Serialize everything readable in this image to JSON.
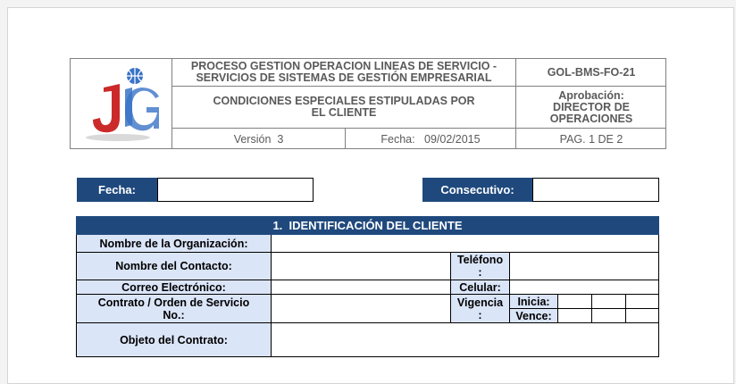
{
  "header": {
    "process_line1": "PROCESO GESTION OPERACION LINEAS DE SERVICIO -",
    "process_line2": "SERVICIOS DE SISTEMAS DE GESTIÓN EMPRESARIAL",
    "doc_code": "GOL-BMS-FO-21",
    "doc_title": "CONDICIONES ESPECIALES ESTIPULADAS POR EL CLIENTE",
    "approval_label": "Aprobación:",
    "approval_value": "DIRECTOR DE OPERACIONES",
    "version": "Versión  3",
    "date": "Fecha:   09/02/2015",
    "page": "PAG. 1 DE 2"
  },
  "top_fields": {
    "fecha_label": "Fecha:",
    "consecutivo_label": "Consecutivo:"
  },
  "section1": {
    "title": "1.  IDENTIFICACIÓN DEL CLIENTE",
    "org_label": "Nombre de la Organización:",
    "contact_label": "Nombre del Contacto:",
    "phone_label": "Teléfono\n:",
    "email_label": "Correo Electrónico:",
    "cell_label": "Celular:",
    "contract_label": "Contrato / Orden de Servicio\nNo.:",
    "vigencia_label": "Vigencia\n:",
    "inicia_label": "Inicia:",
    "vence_label": "Vence:",
    "objeto_label": "Objeto del Contrato:"
  },
  "logo": {
    "primary_color": "#cc2a2a",
    "secondary_color": "#3a73c7"
  }
}
